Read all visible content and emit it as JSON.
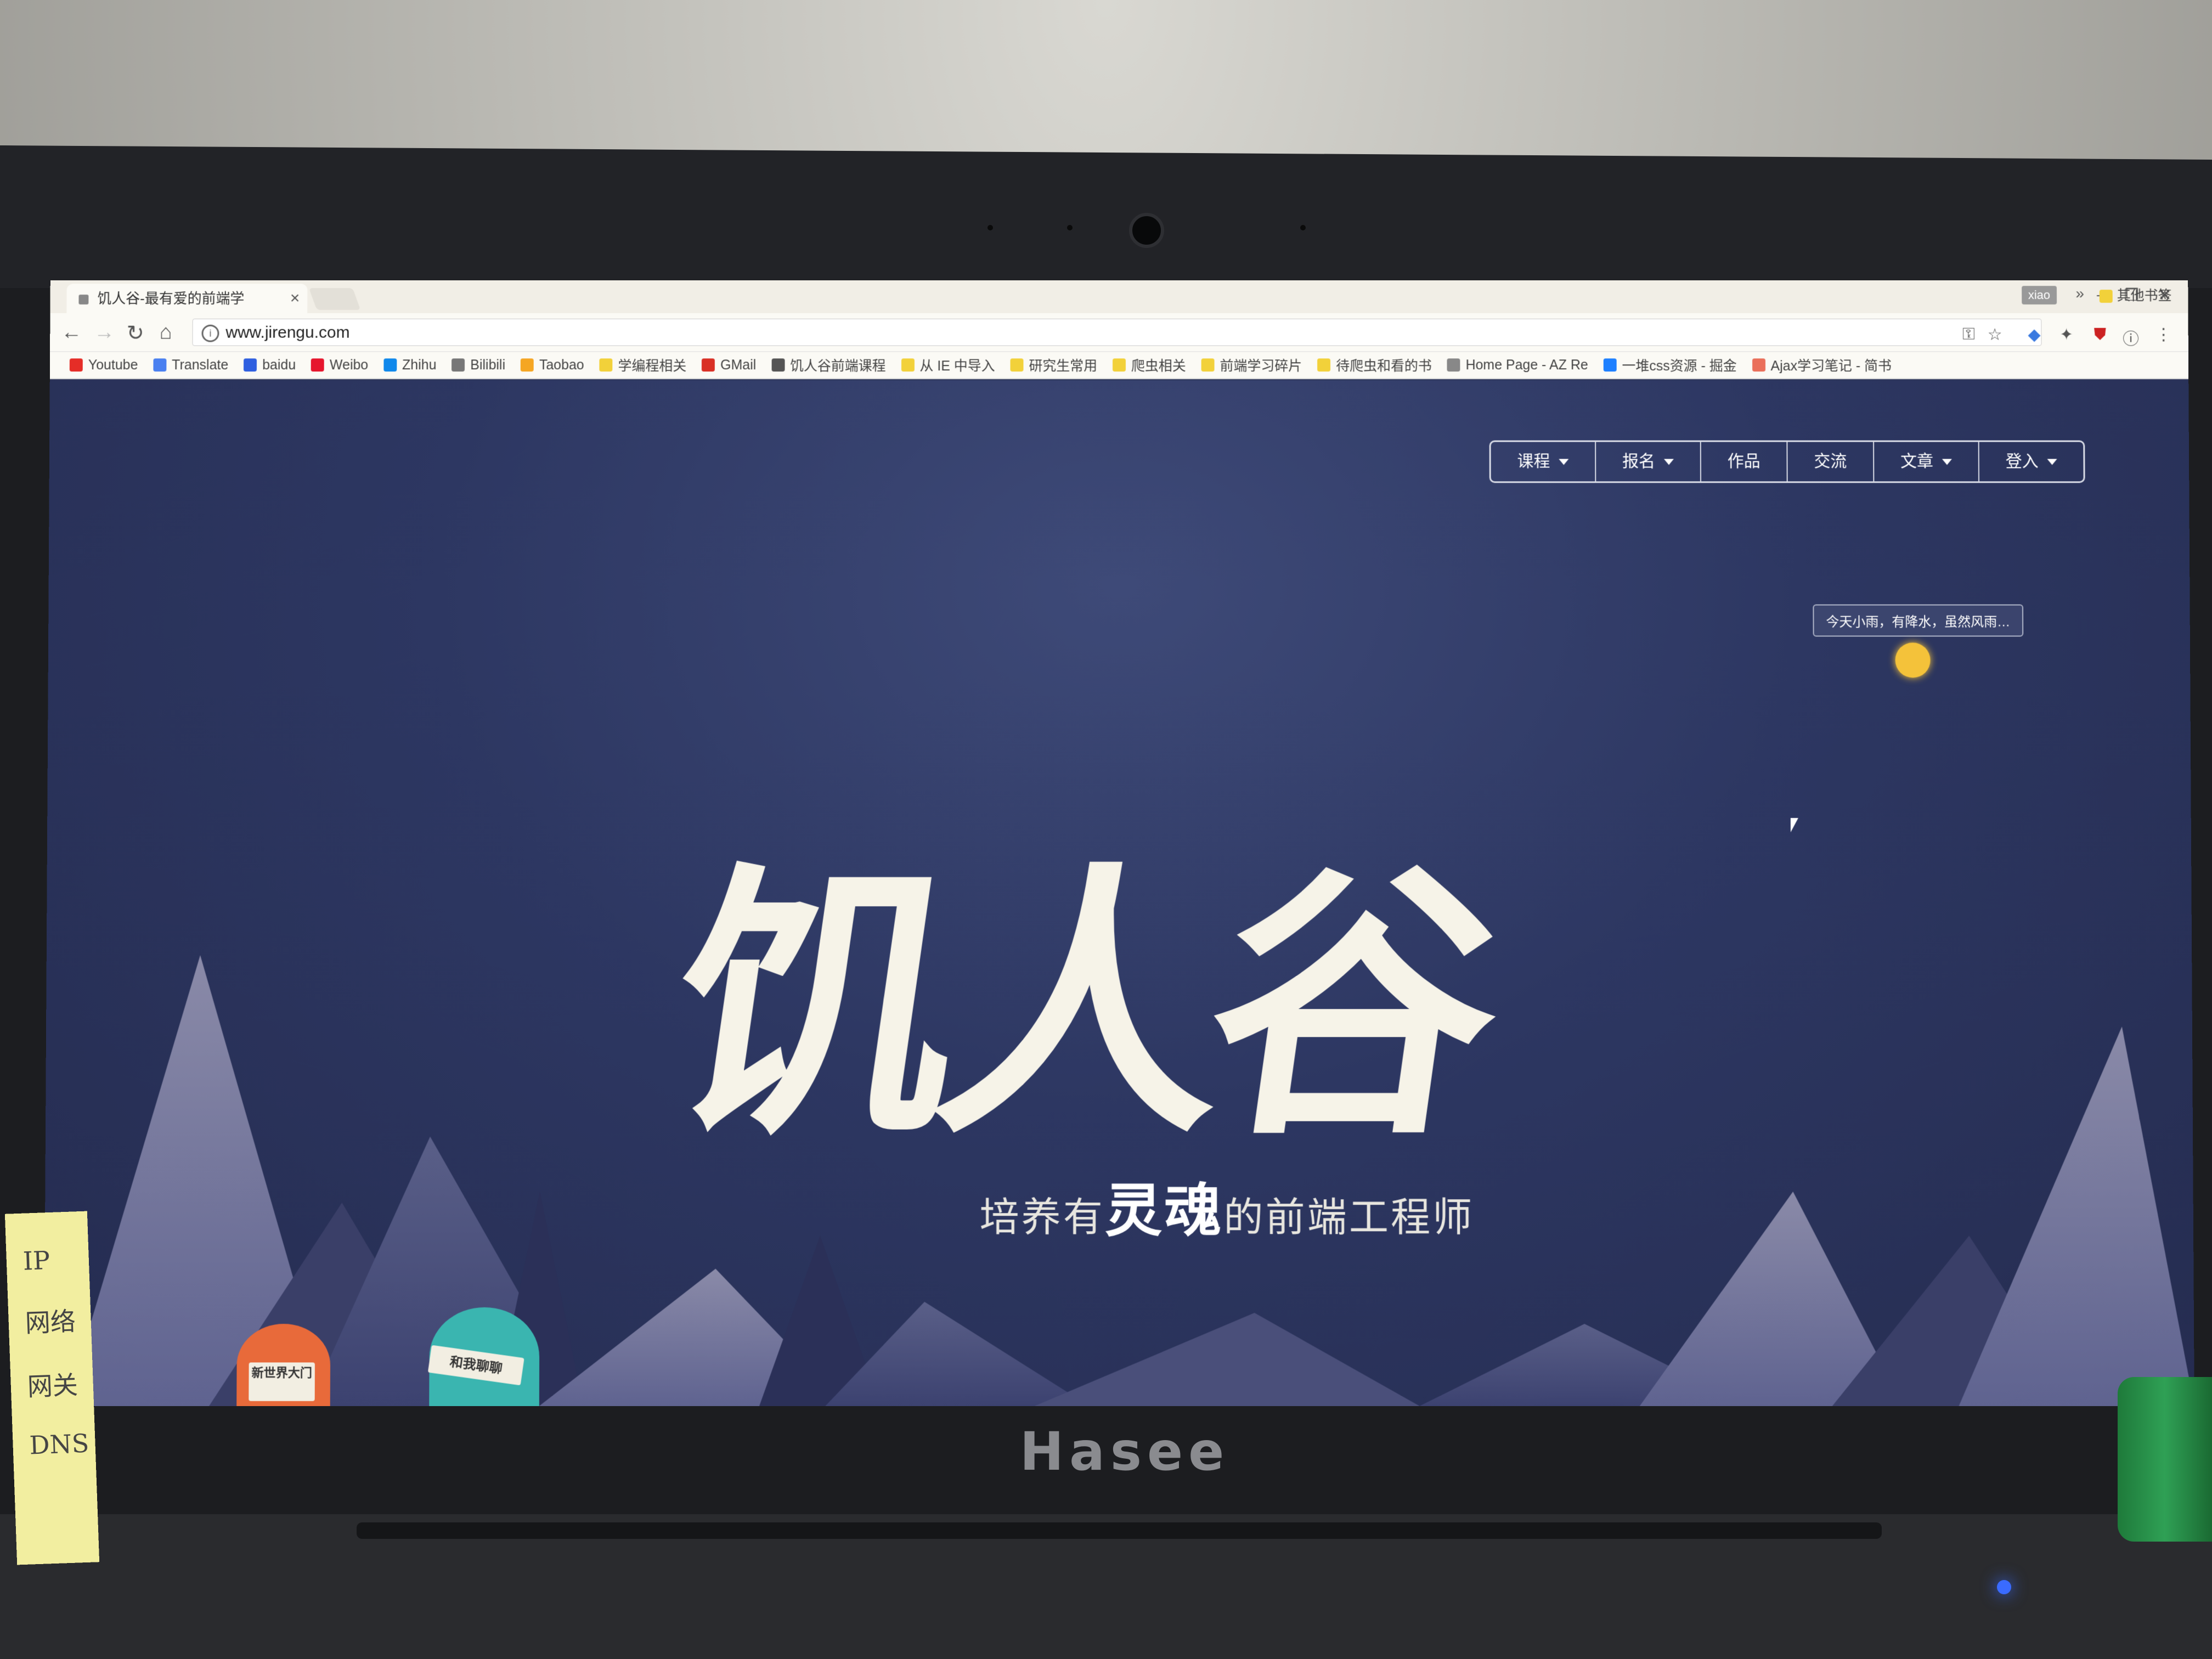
{
  "browser": {
    "tab_title": "饥人谷-最有爱的前端学",
    "profile_name": "xiao",
    "url": "www.jirengu.com",
    "bookmarks": [
      {
        "label": "Youtube",
        "icon": "youtube-icon",
        "color": "#e52d27"
      },
      {
        "label": "Translate",
        "icon": "translate-icon",
        "color": "#4a80f0"
      },
      {
        "label": "baidu",
        "icon": "baidu-icon",
        "color": "#2f5fe0"
      },
      {
        "label": "Weibo",
        "icon": "weibo-icon",
        "color": "#e6162d"
      },
      {
        "label": "Zhihu",
        "icon": "zhihu-icon",
        "color": "#0f88eb"
      },
      {
        "label": "Bilibili",
        "icon": "bilibili-icon",
        "color": "#777777"
      },
      {
        "label": "Taobao",
        "icon": "taobao-icon",
        "color": "#f5a623"
      },
      {
        "label": "学编程相关",
        "icon": "folder-icon",
        "color": "#f2d13a"
      },
      {
        "label": "GMail",
        "icon": "gmail-icon",
        "color": "#d93025"
      },
      {
        "label": "饥人谷前端课程",
        "icon": "jirengu-icon",
        "color": "#555555"
      },
      {
        "label": "从 IE 中导入",
        "icon": "folder-icon",
        "color": "#f2d13a"
      },
      {
        "label": "研究生常用",
        "icon": "folder-icon",
        "color": "#f2d13a"
      },
      {
        "label": "爬虫相关",
        "icon": "folder-icon",
        "color": "#f2d13a"
      },
      {
        "label": "前端学习碎片",
        "icon": "folder-icon",
        "color": "#f2d13a"
      },
      {
        "label": "待爬虫和看的书",
        "icon": "folder-icon",
        "color": "#f2d13a"
      },
      {
        "label": "Home Page - AZ Re",
        "icon": "page-icon",
        "color": "#888888"
      },
      {
        "label": "一堆css资源 - 掘金",
        "icon": "juejin-icon",
        "color": "#1e80ff"
      },
      {
        "label": "Ajax学习笔记 - 简书",
        "icon": "jianshu-icon",
        "color": "#ea6f5a"
      }
    ],
    "bookmarks_more": "»",
    "other_bookmarks": "其他书签"
  },
  "page": {
    "nav": [
      {
        "label": "课程",
        "has_caret": true
      },
      {
        "label": "报名",
        "has_caret": true
      },
      {
        "label": "作品",
        "has_caret": false
      },
      {
        "label": "交流",
        "has_caret": false
      },
      {
        "label": "文章",
        "has_caret": true
      },
      {
        "label": "登入",
        "has_caret": true
      }
    ],
    "weather_bubble": "今天小雨，有降水，虽然风雨…",
    "brand_logo": "饥人谷",
    "tagline_pre": "培养有",
    "tagline_emph": "灵魂",
    "tagline_post": "的前端工程师",
    "mascot_left_sign": "新世界大门",
    "mascot_right_sign": "和我聊聊"
  },
  "device": {
    "brand": "Hasee",
    "sticky_note_lines": [
      "IP",
      "网络",
      "网关",
      "DNS"
    ]
  }
}
